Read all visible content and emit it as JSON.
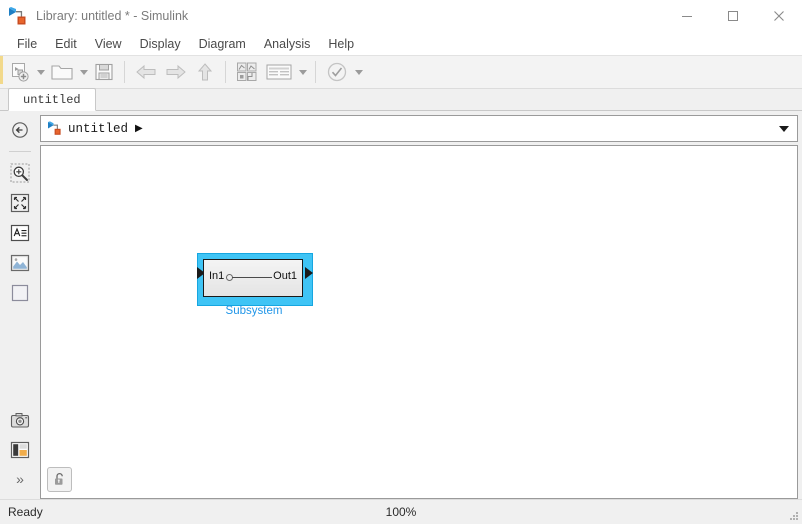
{
  "window": {
    "title": "Library: untitled * - Simulink",
    "app_icon": "simulink-icon",
    "controls": {
      "minimize": "minimize-icon",
      "maximize": "maximize-icon",
      "close": "close-icon"
    }
  },
  "menubar": {
    "items": [
      {
        "label": "File"
      },
      {
        "label": "Edit"
      },
      {
        "label": "View"
      },
      {
        "label": "Display"
      },
      {
        "label": "Diagram"
      },
      {
        "label": "Analysis"
      },
      {
        "label": "Help"
      }
    ]
  },
  "toolbar": {
    "groups": [
      {
        "buttons": [
          {
            "icon": "new-model-icon",
            "has_caret": true
          },
          {
            "icon": "open-folder-icon",
            "has_caret": true
          },
          {
            "icon": "save-icon",
            "has_caret": false
          }
        ]
      },
      {
        "buttons": [
          {
            "icon": "back-arrow-icon",
            "has_caret": false
          },
          {
            "icon": "forward-arrow-icon",
            "has_caret": false
          },
          {
            "icon": "up-arrow-icon",
            "has_caret": false
          }
        ]
      },
      {
        "buttons": [
          {
            "icon": "library-browser-icon",
            "has_caret": false
          },
          {
            "icon": "model-explorer-icon",
            "has_caret": true
          }
        ]
      },
      {
        "buttons": [
          {
            "icon": "update-model-icon",
            "has_caret": true
          }
        ]
      }
    ]
  },
  "tabstrip": {
    "tabs": [
      {
        "label": "untitled",
        "active": true
      }
    ]
  },
  "rail": {
    "top_items": [
      {
        "icon": "navigate-back-icon"
      }
    ],
    "tool_items": [
      {
        "icon": "zoom-region-icon"
      },
      {
        "icon": "fit-to-view-icon"
      },
      {
        "icon": "text-annotation-icon"
      },
      {
        "icon": "image-annotation-icon"
      },
      {
        "icon": "area-annotation-icon"
      }
    ],
    "bottom_items": [
      {
        "icon": "camera-snapshot-icon"
      },
      {
        "icon": "legend-icon"
      },
      {
        "icon": "expand-chevrons-icon",
        "label": "»"
      }
    ]
  },
  "breadcrumb": {
    "icon": "simulink-icon",
    "path_label": "untitled",
    "separator": "▶",
    "dropdown_icon": "chevron-down-icon"
  },
  "canvas": {
    "lock_button": {
      "icon": "unlocked-padlock-icon"
    },
    "blocks": [
      {
        "name": "Subsystem",
        "caption": "Subsystem",
        "selected": true,
        "input_port_label": "In1",
        "output_port_label": "Out1"
      }
    ]
  },
  "statusbar": {
    "status": "Ready",
    "zoom": "100%",
    "grip_icon": "resize-grip-icon"
  },
  "colors": {
    "selection": "#3fc4f5",
    "selection_border": "#16a6e0",
    "caption_blue": "#2196e8",
    "toolbar_bg": "#f3f3f3",
    "chrome_bg": "#f0f0f0",
    "title_text": "#7b7b7b"
  }
}
